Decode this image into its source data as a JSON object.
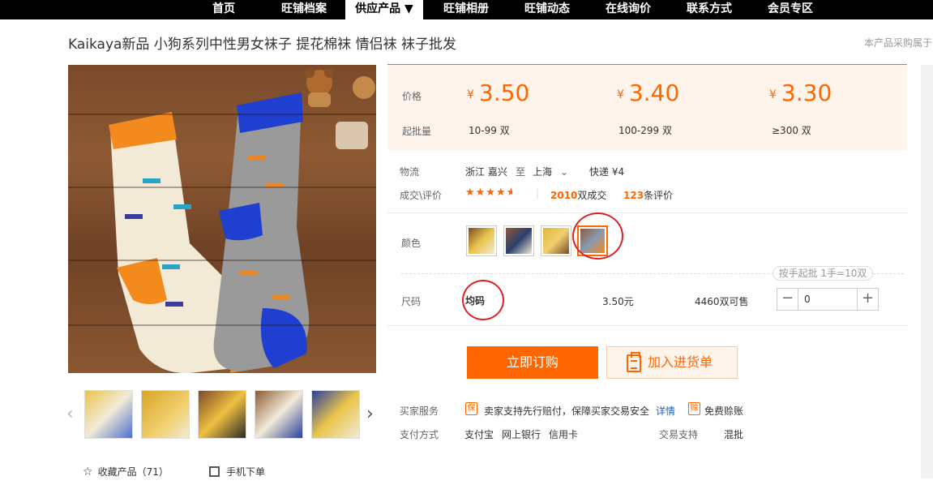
{
  "nav": {
    "items": [
      "首页",
      "旺铺档案",
      "供应产品 ▼",
      "旺铺相册",
      "旺铺动态",
      "在线询价",
      "联系方式",
      "会员专区"
    ]
  },
  "product": {
    "title": "Kaikaya新品 小狗系列中性男女袜子 提花棉袜 情侣袜 袜子批发",
    "right_note": "本产品采购属于"
  },
  "price_box": {
    "price_label": "价格",
    "moq_label": "起批量",
    "currency": "¥",
    "tiers": [
      {
        "price": "3.50",
        "moq": "10-99 双"
      },
      {
        "price": "3.40",
        "moq": "100-299 双"
      },
      {
        "price": "3.30",
        "moq": "≥300 双"
      }
    ]
  },
  "logistics": {
    "label": "物流",
    "from": "浙江 嘉兴",
    "to_word": "至",
    "to": "上海",
    "shipping": "快递 ¥4"
  },
  "deal": {
    "label": "成交\\评价",
    "rating": 4.5,
    "sold_count": "2010",
    "sold_suffix": "双成交",
    "review_count": "123",
    "review_suffix": "条评价"
  },
  "color": {
    "label": "颜色",
    "options": [
      {
        "name": "color-1",
        "swatch": "#caa25a"
      },
      {
        "name": "color-2",
        "swatch": "#2c3e6e"
      },
      {
        "name": "color-3",
        "swatch": "#e0b53a"
      },
      {
        "name": "color-4",
        "swatch": "#8a9ab0"
      }
    ],
    "selected_index": 3
  },
  "size": {
    "tip": "按手起批 1手=10双",
    "label": "尺码",
    "value": "均码",
    "unit_price": "3.50元",
    "stock": "4460双可售",
    "quantity": "0",
    "minus": "−",
    "plus": "+"
  },
  "actions": {
    "buy": "立即订购",
    "add_cart": "加入进货单"
  },
  "services": {
    "buyer_label": "买家服务",
    "guarantee_icon": "保",
    "guarantee_text": "卖家支持先行赔付，保障买家交易安全",
    "detail_link": "详情",
    "free_icon": "赊",
    "free_text": "免费赊账",
    "pay_label": "支付方式",
    "pay_methods": [
      "支付宝",
      "网上银行",
      "信用卡"
    ],
    "trade_label": "交易支持",
    "trade_value": "混批"
  },
  "bottom": {
    "favorite": "收藏产品（71）",
    "mobile": "手机下单"
  },
  "thumbnails": [
    "thumb-1",
    "thumb-2",
    "thumb-3",
    "thumb-4",
    "thumb-5"
  ],
  "colors": {
    "accent": "#ff6600",
    "price_bg": "#fff4ec",
    "highlight_circle": "#e02020"
  }
}
